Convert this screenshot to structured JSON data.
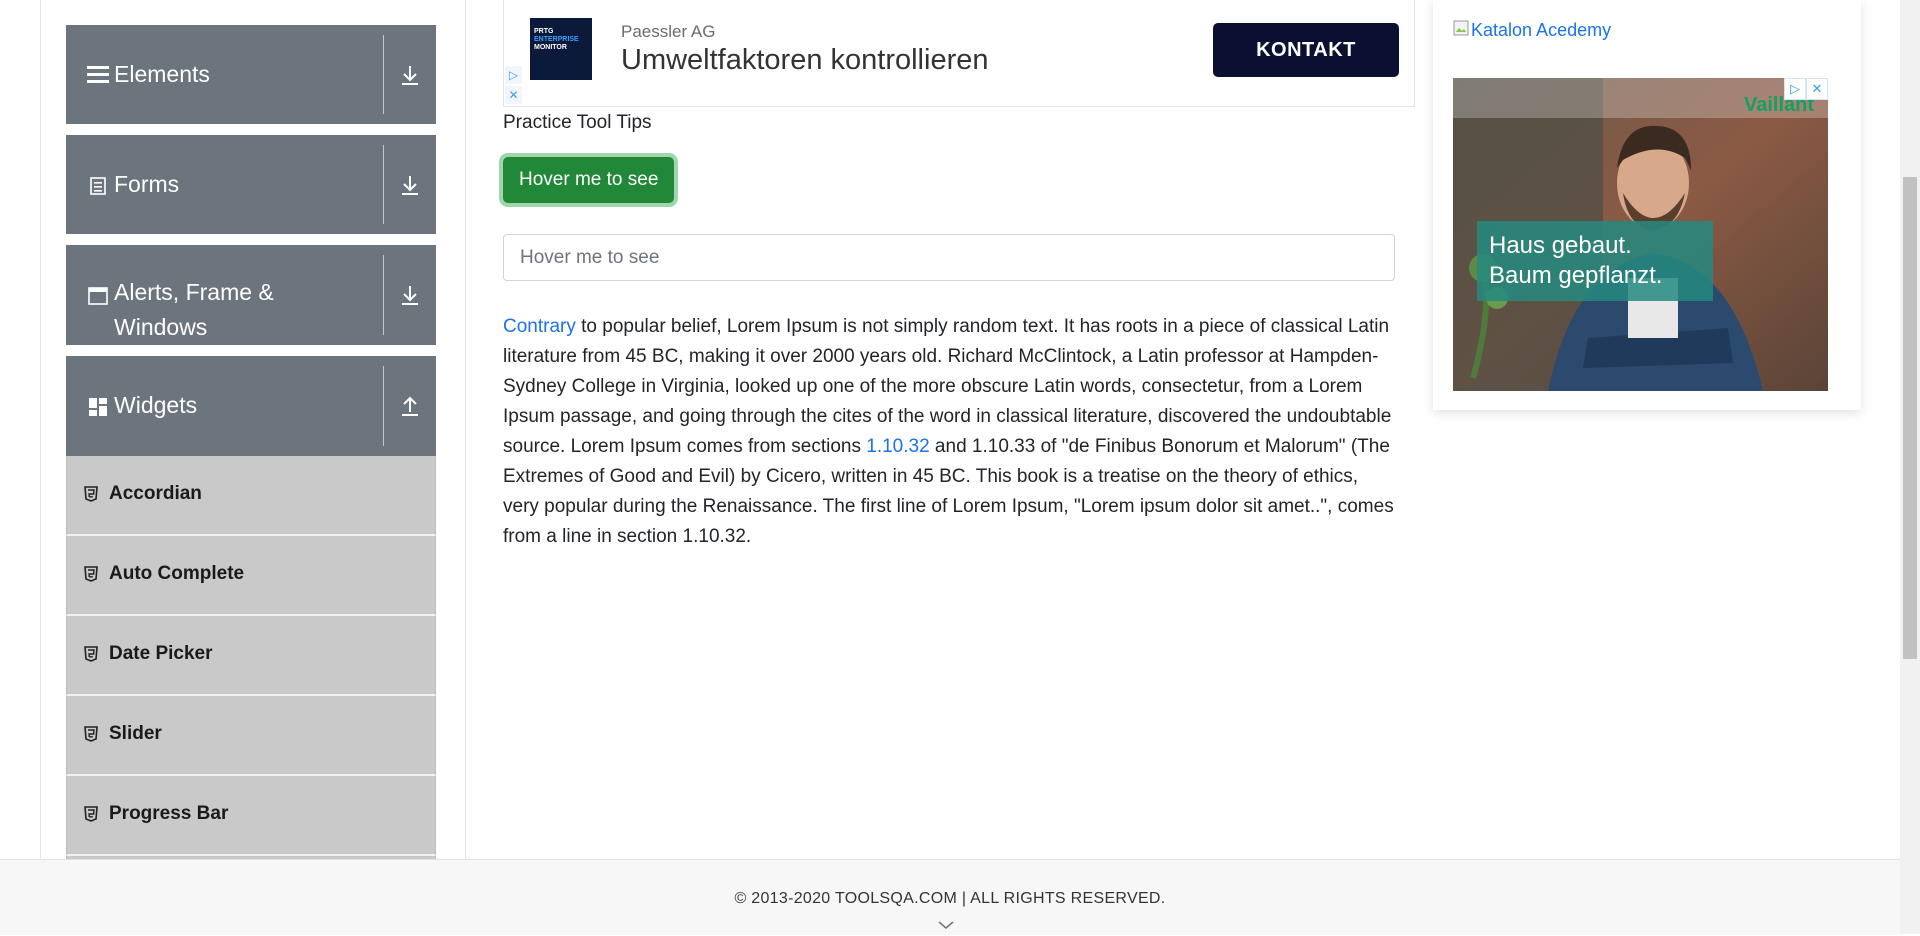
{
  "sidebar": {
    "groups": [
      {
        "label": "Elements",
        "icon": "hamburger-icon",
        "expanded": false
      },
      {
        "label": "Forms",
        "icon": "document-icon",
        "expanded": false
      },
      {
        "label": "Alerts, Frame & Windows",
        "icon": "window-icon",
        "expanded": false
      },
      {
        "label": "Widgets",
        "icon": "grid-icon",
        "expanded": true
      }
    ],
    "widget_items": [
      "Accordian",
      "Auto Complete",
      "Date Picker",
      "Slider",
      "Progress Bar"
    ]
  },
  "top_ad": {
    "logo_lines": [
      "PRTG",
      "ENTERPRISE",
      "MONITOR"
    ],
    "company": "Paessler AG",
    "headline": "Umweltfaktoren kontrollieren",
    "cta": "KONTAKT"
  },
  "main": {
    "section_title": "Practice Tool Tips",
    "hover_button": "Hover me to see",
    "hover_input_placeholder": "Hover me to see",
    "paragraph": {
      "link1": "Contrary",
      "text1": " to popular belief, Lorem Ipsum is not simply random text. It has roots in a piece of classical Latin literature from 45 BC, making it over 2000 years old. Richard McClintock, a Latin professor at Hampden-Sydney College in Virginia, looked up one of the more obscure Latin words, consectetur, from a Lorem Ipsum passage, and going through the cites of the word in classical literature, discovered the undoubtable source. Lorem Ipsum comes from sections ",
      "link2": "1.10.32",
      "text2": " and 1.10.33 of \"de Finibus Bonorum et Malorum\" (The Extremes of Good and Evil) by Cicero, written in 45 BC. This book is a treatise on the theory of ethics, very popular during the Renaissance. The first line of Lorem Ipsum, \"Lorem ipsum dolor sit amet..\", comes from a line in section 1.10.32."
    }
  },
  "right_ad": {
    "katalon_alt": "Katalon Acedemy",
    "brand": "Vaillant",
    "slogan_line1": "Haus gebaut.",
    "slogan_line2": "Baum gepflanzt."
  },
  "footer": {
    "copyright": "© 2013-2020 TOOLSQA.COM | ALL RIGHTS RESERVED."
  },
  "colors": {
    "group_bg": "#6c757d",
    "sub_bg": "#c9c9c9",
    "button_green": "#218838",
    "link_blue": "#1a73e8",
    "ad_navy": "#0b1033"
  }
}
